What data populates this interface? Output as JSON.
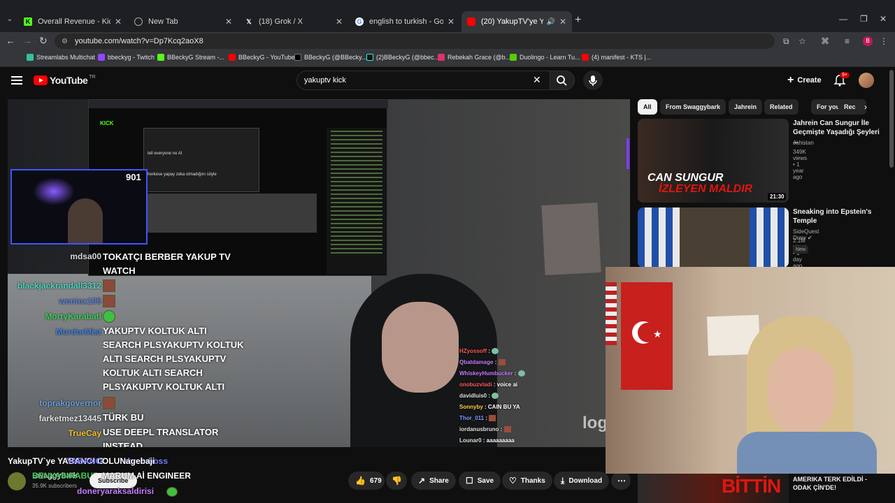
{
  "browser": {
    "tabs": [
      {
        "title": "Overall Revenue - Kick Dashbo...",
        "icon": "kick-icon",
        "active": false
      },
      {
        "title": "New Tab",
        "icon": "globe-icon",
        "active": false
      },
      {
        "title": "(18) Grok / X",
        "icon": "x-icon",
        "active": false
      },
      {
        "title": "english to turkish - Google Sea...",
        "icon": "google-icon",
        "active": false
      },
      {
        "title": "(20) YakupTV'ye YABANCI G...",
        "icon": "youtube-icon",
        "active": true
      }
    ],
    "url": "youtube.com/watch?v=Dp7Kcq2aoX8",
    "profile_initial": "B",
    "bookmarks": [
      "Streamlabs Multichat",
      "bbeckyg - Twitch",
      "BBeckyG Stream -...",
      "BBeckyG - YouTube",
      "BBeckyG (@BBecky...",
      "(2)BBeckyG (@bbec...",
      "Rebekah Grace (@b...",
      "Duolingo - Learn Tu...",
      "(4) manifest - KTS |..."
    ]
  },
  "youtube": {
    "logo_text": "YouTube",
    "region": "TR",
    "search_value": "yakuptv kick",
    "create_label": "Create",
    "notifications": "9+",
    "colors": {
      "accent": "#ff0000",
      "background": "#0f0f0f"
    }
  },
  "player": {
    "cam_count": "901",
    "inner_text_1": "tell everyone no AI",
    "inner_text_2": "herkese yapay zeka olmadığını söyle",
    "chat_left": [
      {
        "user": "mdsa00",
        "msg": "TOKATÇI BERBER YAKUP TV WATCH",
        "color": "#d8d8d8"
      },
      {
        "user": "blackjackrandall3312",
        "msg": "",
        "color": "#4fd6c0",
        "emote": true
      },
      {
        "user": "wentex105",
        "msg": "",
        "color": "#5a7fd6",
        "emote": true
      },
      {
        "user": "MortyKarabatl",
        "msg": "",
        "color": "#3fcf5c",
        "emote": true,
        "green": true
      },
      {
        "user": "MordorMist",
        "msg": "YAKUPTV KOLTUK ALTI SEARCH PLSYAKUPTV KOLTUK ALTI SEARCH PLSYAKUPTV KOLTUK ALTI SEARCH PLSYAKUPTV KOLTUK ALTI SEARCH PLS",
        "color": "#3f7fe0"
      },
      {
        "user": "toprakgovernor",
        "msg": "",
        "color": "#6a9fd6",
        "emote": true
      },
      {
        "user": "farketmez13445",
        "msg": "TÜRK BU",
        "color": "#e0e0e0"
      },
      {
        "user": "TrueCay",
        "msg": "USE DEEPL TRANSLATOR INSTEAD",
        "color": "#f0c030"
      }
    ],
    "chat_right": [
      {
        "user": "HZyossoff",
        "msg": "",
        "color": "#ff5a5a",
        "emote": "g"
      },
      {
        "user": "Qbatdamage",
        "msg": "",
        "color": "#c77dff",
        "emote": "r"
      },
      {
        "user": "WhiskeyHumbucker",
        "msg": "",
        "color": "#c77dff",
        "emote": "g"
      },
      {
        "user": "onobuzvladi",
        "msg": "voice ai",
        "color": "#ff5a5a"
      },
      {
        "user": "davidluis0",
        "msg": "",
        "color": "#e0e0e0",
        "emote": "g"
      },
      {
        "user": "Sonnyby",
        "msg": "CAIN BU YA",
        "color": "#ffd24a"
      },
      {
        "user": "Thor_011",
        "msg": "",
        "color": "#7d9bff",
        "emote": "r"
      },
      {
        "user": "iordanusbruno",
        "msg": "",
        "color": "#e0e0e0",
        "emote": "r"
      },
      {
        "user": "Lounar0",
        "msg": "aaaaaaaaa",
        "color": "#e0e0e0"
      }
    ]
  },
  "video": {
    "title": "YakupTV`ye YABANCI G",
    "title_overlay": "YABANCI",
    "channel_name": "Swaggybark",
    "subscribers": "35.9K subscribers",
    "subscribe_label": "Subscribe",
    "overlay_chat": [
      {
        "user": "ahreinboss",
        "msg": "OLUNagebaji",
        "color": "#7b7bff"
      },
      {
        "user": "BENYASIRABUR",
        "msg": "MARUM Aİ ENGINEER",
        "color": "#3fcf5c"
      },
      {
        "user": "doneryaraksaldirisi",
        "msg": "",
        "color": "#c77dff"
      }
    ],
    "likes": "679",
    "share_label": "Share",
    "save_label": "Save",
    "thanks_label": "Thanks",
    "download_label": "Download"
  },
  "sidebar": {
    "chips": [
      "All",
      "From Swaggybark",
      "Jahrein",
      "Related",
      "For you",
      "Rec"
    ],
    "recs": [
      {
        "title": "Jahrein Can Sungur İle Geçmişte Yaşadığı Şeyleri ...",
        "channel": "Jahistan",
        "meta": "349K views • 1 year ago",
        "duration": "21:30",
        "thumb_text_1": "CAN SUNGUR",
        "thumb_text_2": "İZLEYEN MALDIR"
      },
      {
        "title": "Sneaking into Epstein's Temple",
        "channel": "SideQuest Drew",
        "meta": "2.1M views • 1 day ago",
        "badge": "New"
      },
      {
        "title": "AMERIKA TERK EDİLDİ - ODAK ÇİN'DE!",
        "thumb_text": "BİTTİN"
      }
    ]
  }
}
